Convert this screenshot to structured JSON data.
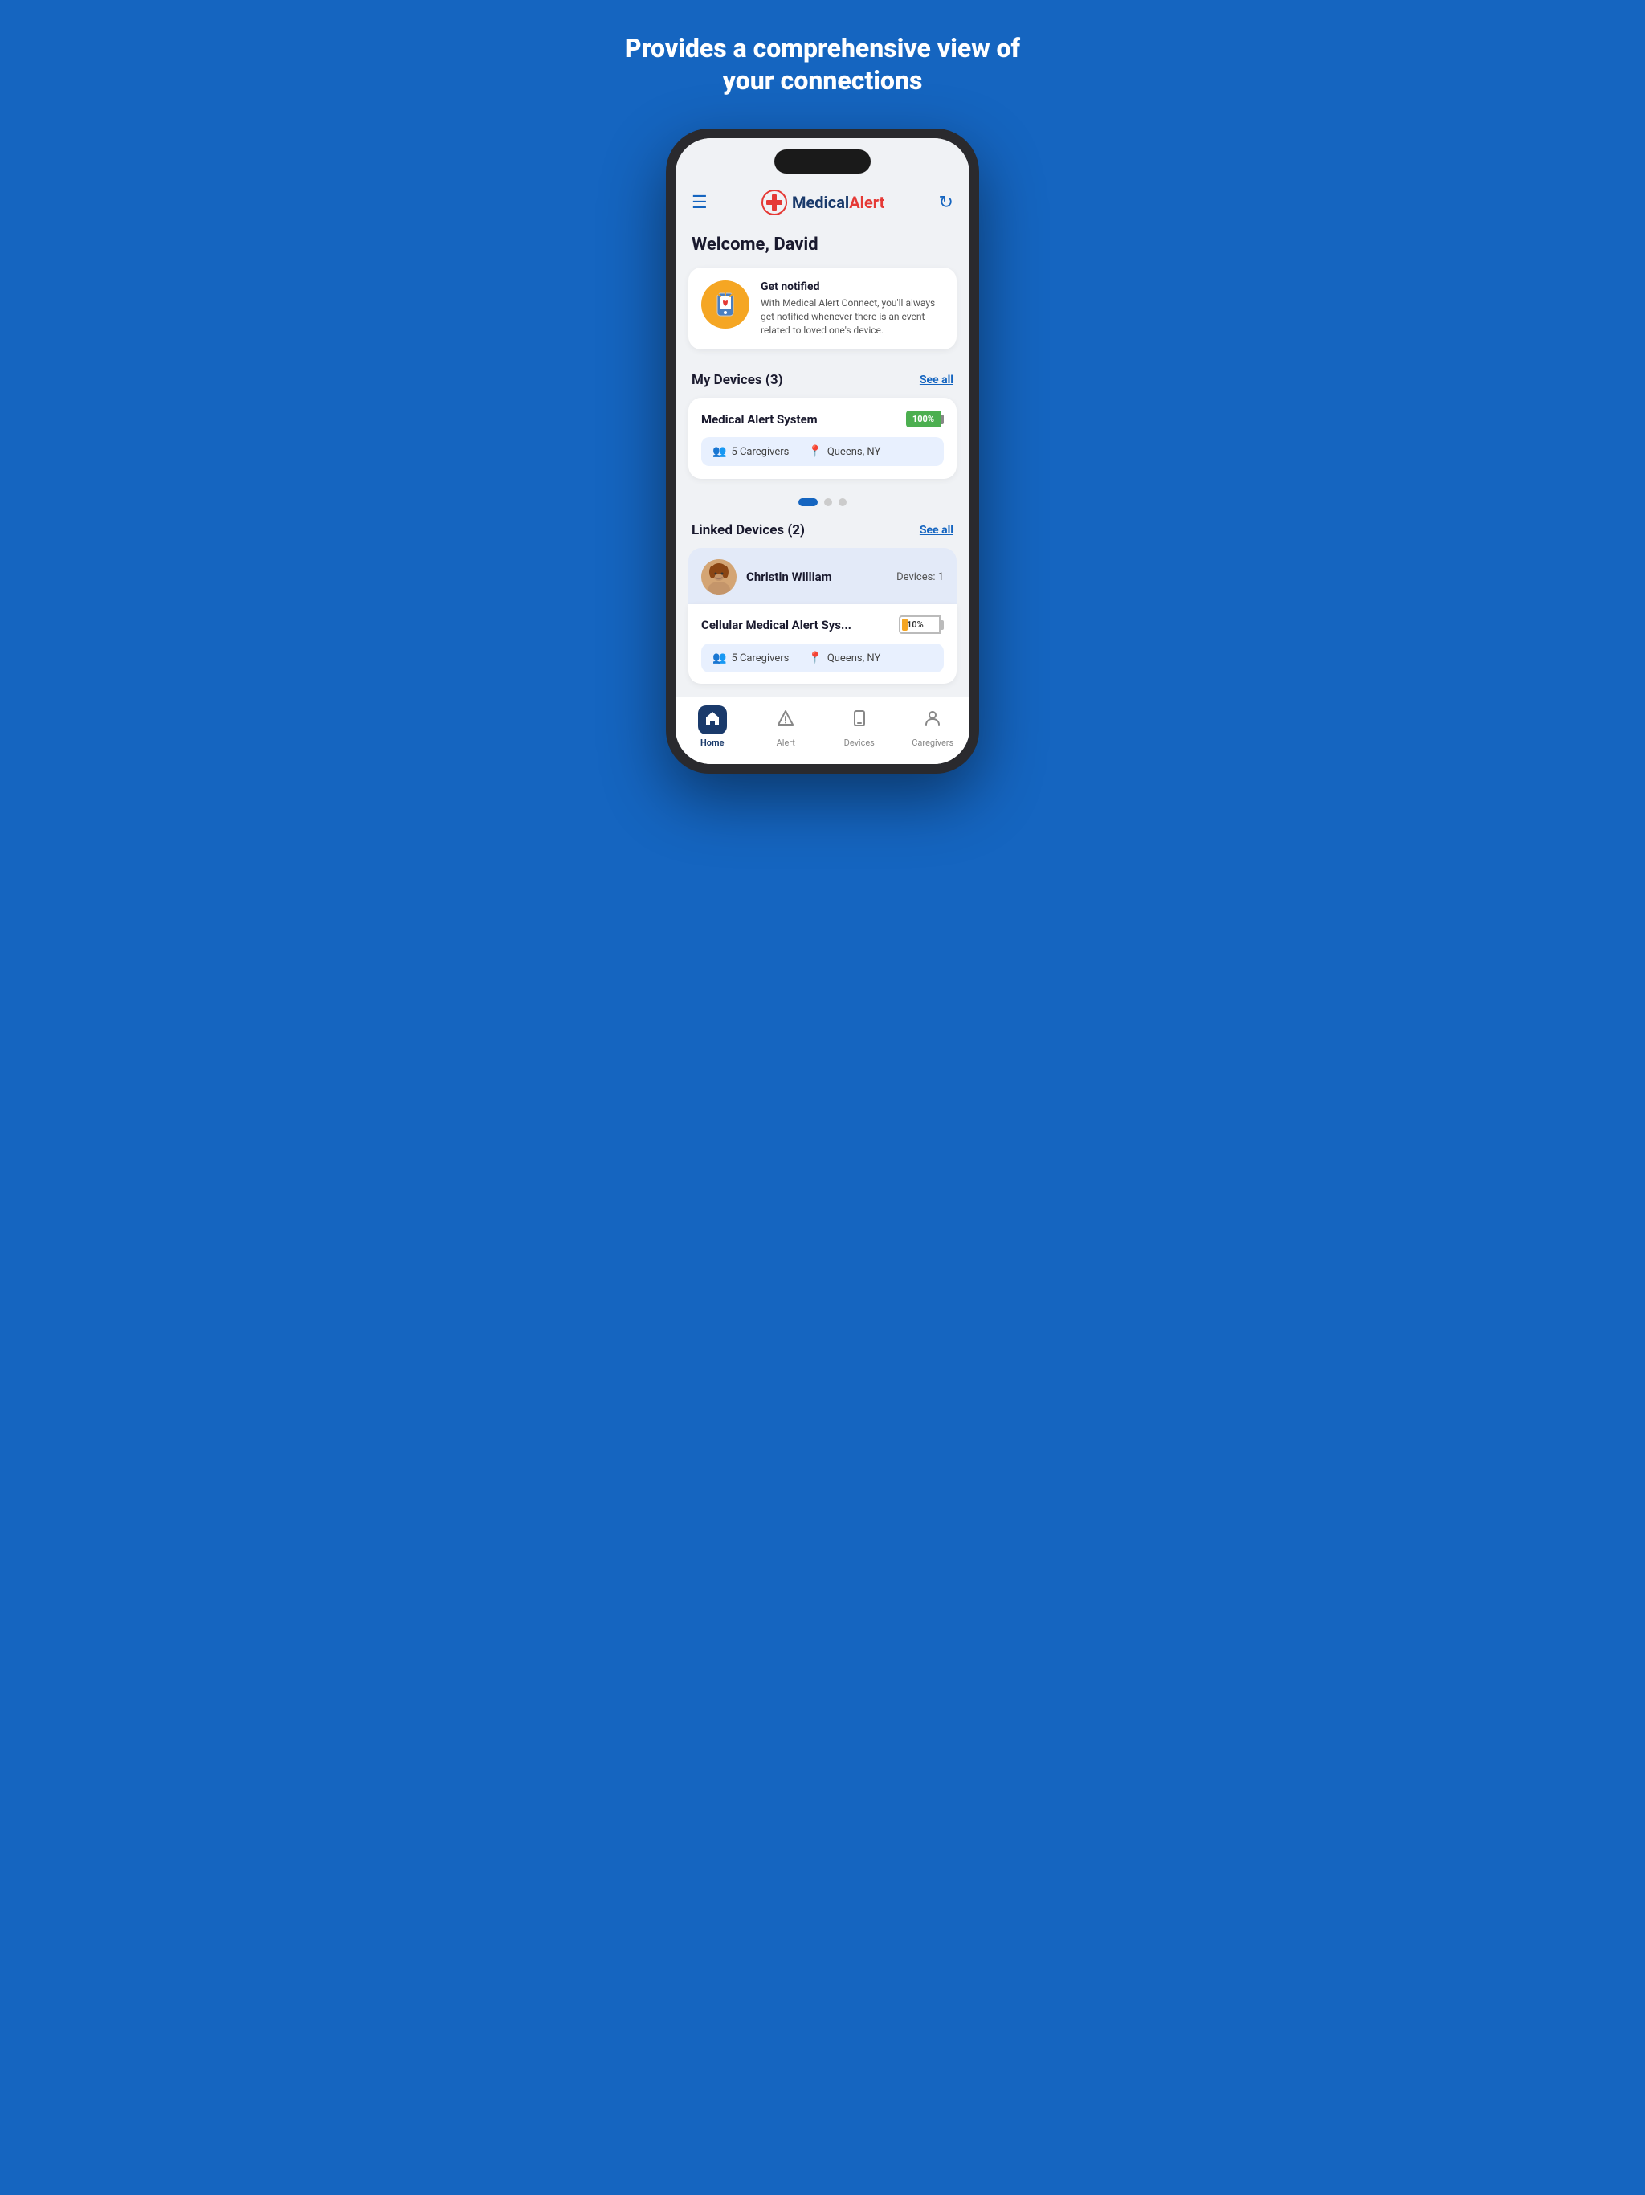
{
  "headline": "Provides a comprehensive view of your connections",
  "header": {
    "logo_medical": "Medical",
    "logo_alert": "Alert",
    "menu_label": "☰",
    "refresh_label": "↻"
  },
  "welcome": {
    "text": "Welcome, David"
  },
  "notification": {
    "title": "Get notified",
    "body": "With Medical Alert Connect, you'll always get notified whenever there is an event related to loved one's device."
  },
  "my_devices": {
    "section_title": "My Devices (3)",
    "see_all": "See all",
    "device_name": "Medical Alert System",
    "battery_percent": "100%",
    "caregivers": "5 Caregivers",
    "location": "Queens, NY"
  },
  "linked_devices": {
    "section_title": "Linked Devices (2)",
    "see_all": "See all",
    "person_name": "Christin William",
    "devices_count": "Devices: 1",
    "device_name": "Cellular Medical Alert Sys...",
    "battery_percent": "10%",
    "caregivers": "5 Caregivers",
    "location": "Queens, NY"
  },
  "nav": {
    "home": "Home",
    "alert": "Alert",
    "devices": "Devices",
    "caregivers": "Caregivers"
  },
  "carousel_dots": [
    true,
    false,
    false
  ]
}
